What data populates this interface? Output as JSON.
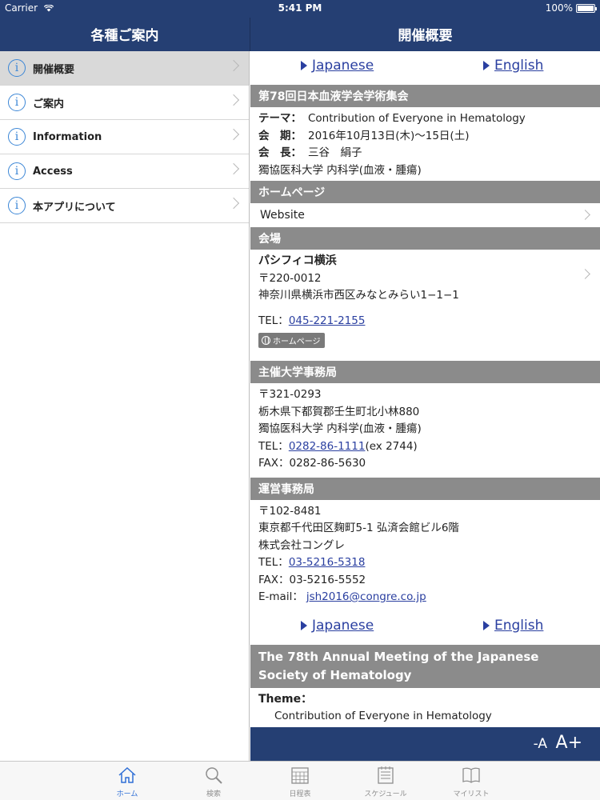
{
  "status": {
    "carrier": "Carrier",
    "time": "5:41 PM",
    "battery": "100%"
  },
  "nav": {
    "left_title": "各種ご案内",
    "right_title": "開催概要"
  },
  "menu": [
    {
      "label": "開催概要"
    },
    {
      "label": "ご案内"
    },
    {
      "label": "Information"
    },
    {
      "label": "Access"
    },
    {
      "label": "本アプリについて"
    }
  ],
  "lang": {
    "japanese": "Japanese",
    "english": "English"
  },
  "meeting": {
    "title": "第78回日本血液学会学術集会",
    "theme_label": "テーマ：",
    "theme": "Contribution of Everyone in Hematology",
    "dates_label": "会　期：",
    "dates": "2016年10月13日(木)～15日(土)",
    "president_label": "会　長：",
    "president": "三谷　絹子",
    "president_affil": "獨協医科大学 内科学(血液・腫瘍)"
  },
  "homepage": {
    "header": "ホームページ",
    "website": "Website"
  },
  "venue": {
    "header": "会場",
    "name": "パシフィコ横浜",
    "zip": "〒220-0012",
    "address": "神奈川県横浜市西区みなとみらい1−1−1",
    "tel_label": "TEL：",
    "tel": "045-221-2155",
    "hp_button": "ホームページ"
  },
  "organizer": {
    "header": "主催大学事務局",
    "zip": "〒321-0293",
    "address": "栃木県下都賀郡壬生町北小林880",
    "affil": "獨協医科大学 内科学(血液・腫瘍)",
    "tel_label": "TEL：",
    "tel": "0282-86-1111",
    "ext": "(ex 2744)",
    "fax": "FAX：0282-86-5630"
  },
  "office": {
    "header": "運営事務局",
    "zip": "〒102-8481",
    "address": "東京都千代田区麹町5-1 弘済会館ビル6階",
    "company": "株式会社コングレ",
    "tel_label": "TEL：",
    "tel": "03-5216-5318",
    "fax": "FAX：03-5216-5552",
    "email_label": "E-mail：",
    "email": "jsh2016@congre.co.jp"
  },
  "english": {
    "title": "The 78th Annual Meeting of the Japanese Society of Hematology",
    "theme_label": "Theme：",
    "theme": "Contribution of Everyone in Hematology"
  },
  "fontsize": {
    "smaller": "-A",
    "larger": "A+"
  },
  "tabs": [
    {
      "label": "ホーム",
      "icon": "home-icon"
    },
    {
      "label": "検索",
      "icon": "search-icon"
    },
    {
      "label": "日程表",
      "icon": "calendar-icon"
    },
    {
      "label": "スケジュール",
      "icon": "schedule-icon"
    },
    {
      "label": "マイリスト",
      "icon": "book-icon"
    }
  ],
  "colors": {
    "navbar": "#253f73",
    "section_header": "#8b8b8b",
    "link": "#2a3fa0",
    "tab_active": "#2f6fd6"
  }
}
